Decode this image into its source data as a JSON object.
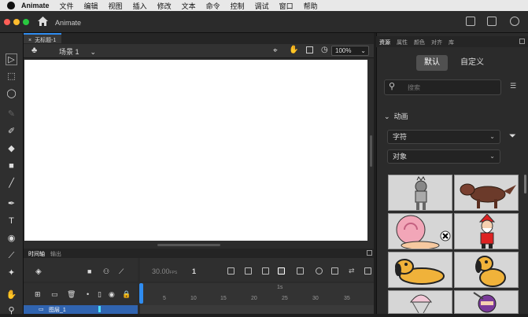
{
  "menubar": {
    "app": "Animate",
    "items": [
      "文件",
      "编辑",
      "视图",
      "插入",
      "修改",
      "文本",
      "命令",
      "控制",
      "调试",
      "窗口",
      "帮助"
    ]
  },
  "window": {
    "title": "Animate"
  },
  "document": {
    "tab": "无标题-1"
  },
  "stage": {
    "scene": "场景 1",
    "zoom": "100%"
  },
  "timeline": {
    "tabs": [
      "时间轴",
      "输出"
    ],
    "fps": "30.00",
    "fps_unit": "FPS",
    "frame": "1",
    "time_marker": "1s",
    "ticks": [
      "5",
      "10",
      "15",
      "20",
      "25",
      "30",
      "35"
    ],
    "layer_name": "图层_1"
  },
  "right_panel": {
    "tabs": [
      "资源",
      "属性",
      "颜色",
      "对齐",
      "库"
    ],
    "segment": {
      "default": "默认",
      "custom": "自定义"
    },
    "search_placeholder": "搜索",
    "section": "动画",
    "filter1": "字符",
    "filter2": "对象",
    "thumbnails": [
      "character-robot",
      "character-wolf",
      "character-snail",
      "character-santa",
      "character-dog-lying",
      "character-dog-sitting",
      "character-parachute",
      "character-ninja"
    ]
  },
  "colors": {
    "accent": "#2f8cf0",
    "stage": "#ffffff",
    "chrome": "#2b2b2b"
  }
}
